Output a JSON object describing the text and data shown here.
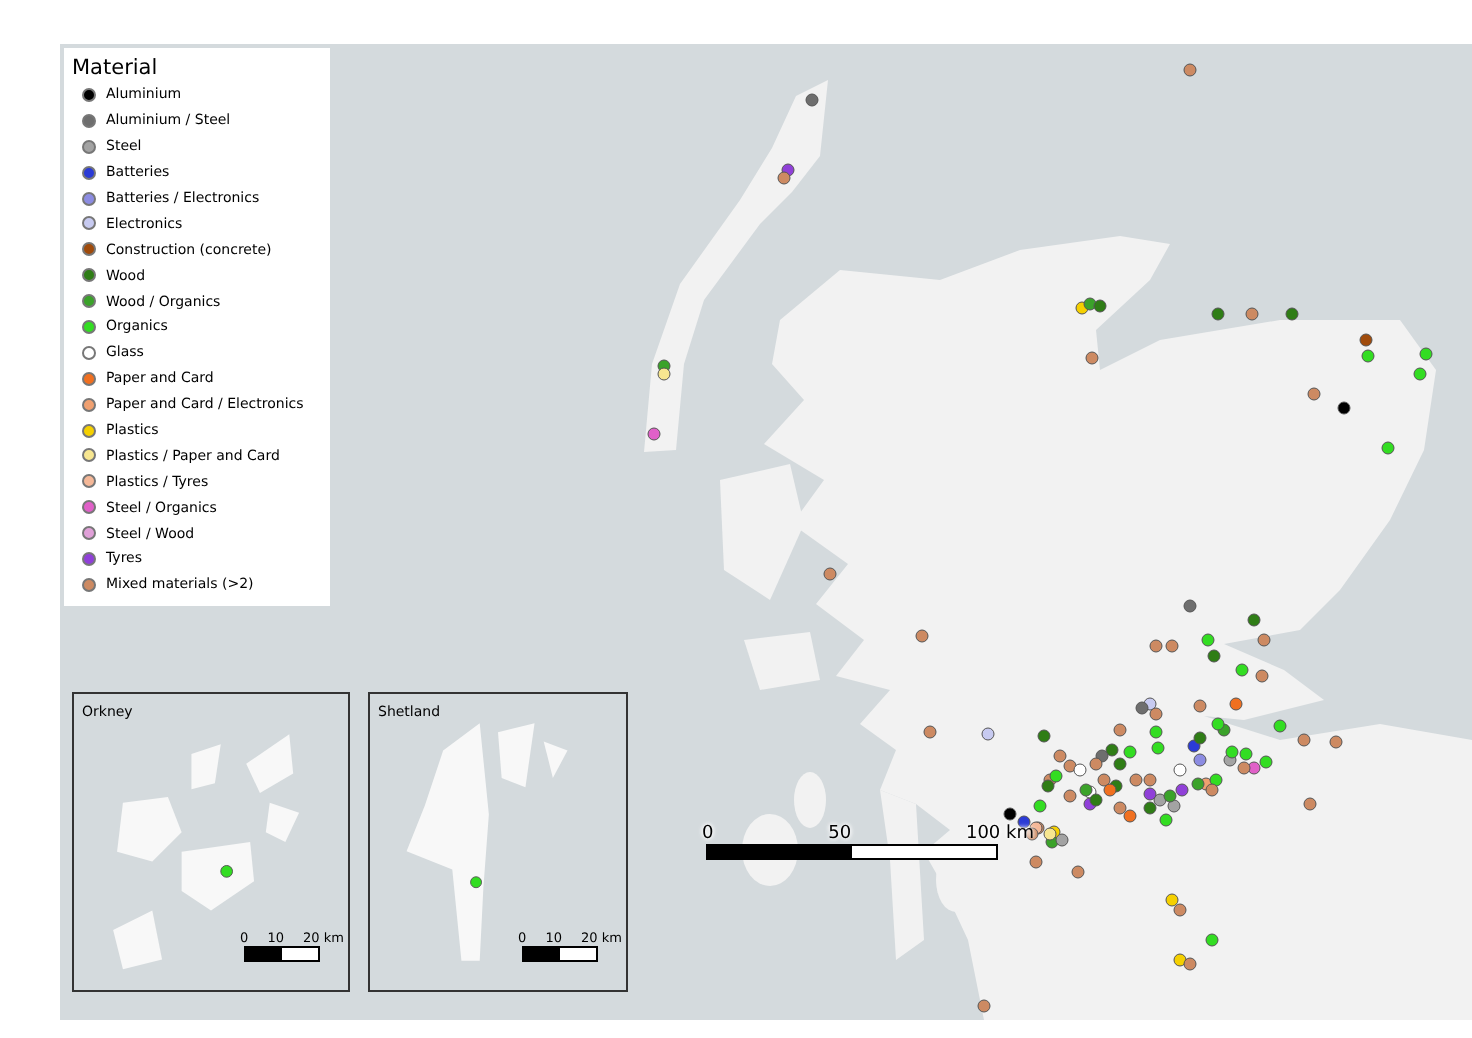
{
  "legend": {
    "title": "Material",
    "items": [
      {
        "label": "Aluminium",
        "color": "#000000"
      },
      {
        "label": "Aluminium / Steel",
        "color": "#6e6e6e"
      },
      {
        "label": "Steel",
        "color": "#a3a3a3"
      },
      {
        "label": "Batteries",
        "color": "#2b3bd6"
      },
      {
        "label": "Batteries / Electronics",
        "color": "#8c8ce2"
      },
      {
        "label": "Electronics",
        "color": "#c7caf0"
      },
      {
        "label": "Construction (concrete)",
        "color": "#a04b0b"
      },
      {
        "label": "Wood",
        "color": "#2f7d16"
      },
      {
        "label": "Wood / Organics",
        "color": "#3ba22a"
      },
      {
        "label": "Organics",
        "color": "#33dd22"
      },
      {
        "label": "Glass",
        "color": "#ffffff"
      },
      {
        "label": "Paper and Card",
        "color": "#f07020"
      },
      {
        "label": "Paper and Card / Electronics",
        "color": "#f0a070"
      },
      {
        "label": "Plastics",
        "color": "#f5d000"
      },
      {
        "label": "Plastics / Paper and Card",
        "color": "#f7e690"
      },
      {
        "label": "Plastics / Tyres",
        "color": "#f5b898"
      },
      {
        "label": "Steel / Organics",
        "color": "#e060c8"
      },
      {
        "label": "Steel / Wood",
        "color": "#e0a0d8"
      },
      {
        "label": "Tyres",
        "color": "#9040d8"
      },
      {
        "label": "Mixed materials (>2)",
        "color": "#cd8a62"
      }
    ]
  },
  "insets": [
    {
      "title": "Orkney",
      "scale_labels": [
        "0",
        "10",
        "20 km"
      ]
    },
    {
      "title": "Shetland",
      "scale_labels": [
        "0",
        "10",
        "20 km"
      ]
    }
  ],
  "scale_bar": {
    "labels": [
      "0",
      "50",
      "100 km"
    ]
  }
}
